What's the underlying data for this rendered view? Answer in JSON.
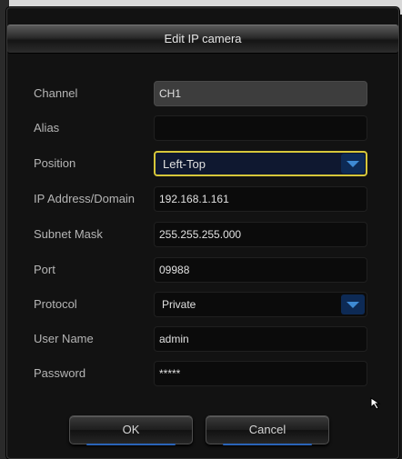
{
  "dialog": {
    "title": "Edit IP camera"
  },
  "form": {
    "channel": {
      "label": "Channel",
      "value": "CH1"
    },
    "alias": {
      "label": "Alias",
      "value": ""
    },
    "position": {
      "label": "Position",
      "value": "Left-Top"
    },
    "ip": {
      "label": "IP Address/Domain",
      "value": "192.168.1.161"
    },
    "subnet": {
      "label": "Subnet Mask",
      "value": "255.255.255.000"
    },
    "port": {
      "label": "Port",
      "value": "09988"
    },
    "protocol": {
      "label": "Protocol",
      "value": "Private"
    },
    "username": {
      "label": "User Name",
      "value": "admin"
    },
    "password": {
      "label": "Password",
      "value": "*****"
    }
  },
  "buttons": {
    "ok": "OK",
    "cancel": "Cancel"
  },
  "colors": {
    "focus_border": "#d6c63a",
    "dropdown_arrow": "#3e8ad4",
    "button_underline": "#2a64b8"
  },
  "icons": {
    "dropdown": "chevron-down-icon",
    "pointer": "mouse-pointer-icon"
  }
}
